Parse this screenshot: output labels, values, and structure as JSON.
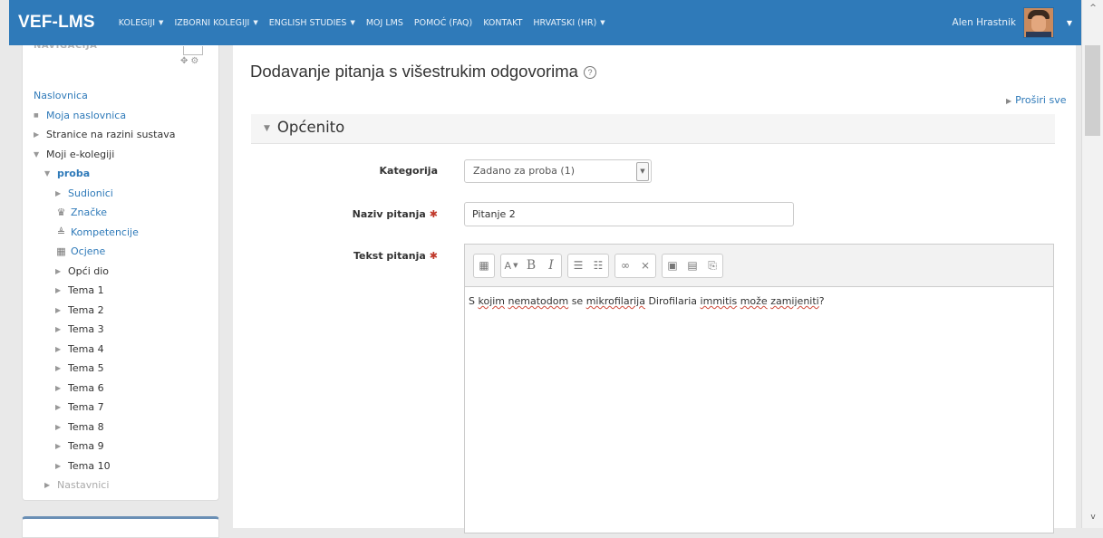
{
  "navbar": {
    "brand": "VEF-LMS",
    "menu": [
      {
        "label": "KOLEGIJI",
        "dropdown": true
      },
      {
        "label": "IZBORNI KOLEGIJI",
        "dropdown": true
      },
      {
        "label": "ENGLISH STUDIES",
        "dropdown": true
      },
      {
        "label": "MOJ LMS",
        "dropdown": false
      },
      {
        "label": "POMOĆ (FAQ)",
        "dropdown": false
      },
      {
        "label": "KONTAKT",
        "dropdown": false
      },
      {
        "label": "HRVATSKI (HR)",
        "dropdown": true
      }
    ],
    "user_name": "Alen Hrastnik",
    "color": "#2f7ab9"
  },
  "sidebar": {
    "block_title": "NAVIGACIJA",
    "tree": [
      {
        "label": "Naslovnica",
        "style": "link",
        "marker": ""
      },
      {
        "label": "Moja naslovnica",
        "style": "link",
        "marker": "square"
      },
      {
        "label": "Stranice na razini sustava",
        "style": "plain",
        "marker": "collapsed"
      },
      {
        "label": "Moji e-kolegiji",
        "style": "plain",
        "marker": "expanded"
      },
      {
        "label": "proba",
        "style": "bold",
        "marker": "expanded"
      },
      {
        "label": "Sudionici",
        "style": "link",
        "marker": "collapsed"
      },
      {
        "label": "Značke",
        "style": "link",
        "marker": "",
        "icon": "trophy-icon"
      },
      {
        "label": "Kompetencije",
        "style": "link",
        "marker": "",
        "icon": "competency-icon"
      },
      {
        "label": "Ocjene",
        "style": "link",
        "marker": "",
        "icon": "grades-table-icon"
      },
      {
        "label": "Opći dio",
        "style": "plain",
        "marker": "collapsed"
      },
      {
        "label": "Tema 1",
        "style": "plain",
        "marker": "collapsed"
      },
      {
        "label": "Tema 2",
        "style": "plain",
        "marker": "collapsed"
      },
      {
        "label": "Tema 3",
        "style": "plain",
        "marker": "collapsed"
      },
      {
        "label": "Tema 4",
        "style": "plain",
        "marker": "collapsed"
      },
      {
        "label": "Tema 5",
        "style": "plain",
        "marker": "collapsed"
      },
      {
        "label": "Tema 6",
        "style": "plain",
        "marker": "collapsed"
      },
      {
        "label": "Tema 7",
        "style": "plain",
        "marker": "collapsed"
      },
      {
        "label": "Tema 8",
        "style": "plain",
        "marker": "collapsed"
      },
      {
        "label": "Tema 9",
        "style": "plain",
        "marker": "collapsed"
      },
      {
        "label": "Tema 10",
        "style": "plain",
        "marker": "collapsed"
      },
      {
        "label": "Nastavnici",
        "style": "muted",
        "marker": "collapsed"
      }
    ]
  },
  "main": {
    "page_title": "Dodavanje pitanja s višestrukim odgovorima",
    "expand_all": "Proširi sve",
    "section_title": "Općenito",
    "fields": {
      "category_label": "Kategorija",
      "category_value": "Zadano za proba (1)",
      "name_label": "Naziv pitanja",
      "name_value": "Pitanje 2",
      "text_label": "Tekst pitanja"
    },
    "editor": {
      "toolbar_groups": [
        [
          "toolbar-toggle-icon"
        ],
        [
          "font-style-icon",
          "bold-icon",
          "italic-icon"
        ],
        [
          "unordered-list-icon",
          "ordered-list-icon"
        ],
        [
          "link-icon",
          "unlink-icon"
        ],
        [
          "image-icon",
          "media-icon",
          "manage-files-icon"
        ]
      ],
      "content_parts": [
        {
          "text": "S ",
          "spell": false
        },
        {
          "text": "kojim",
          "spell": true
        },
        {
          "text": " ",
          "spell": false
        },
        {
          "text": "nematodom",
          "spell": true
        },
        {
          "text": " se ",
          "spell": false
        },
        {
          "text": "mikrofilarija",
          "spell": true
        },
        {
          "text": " Dirofilaria ",
          "spell": false
        },
        {
          "text": "immitis",
          "spell": true
        },
        {
          "text": " ",
          "spell": false
        },
        {
          "text": "može",
          "spell": true
        },
        {
          "text": " ",
          "spell": false
        },
        {
          "text": "zamijeniti",
          "spell": true
        },
        {
          "text": "?",
          "spell": false
        }
      ]
    }
  }
}
